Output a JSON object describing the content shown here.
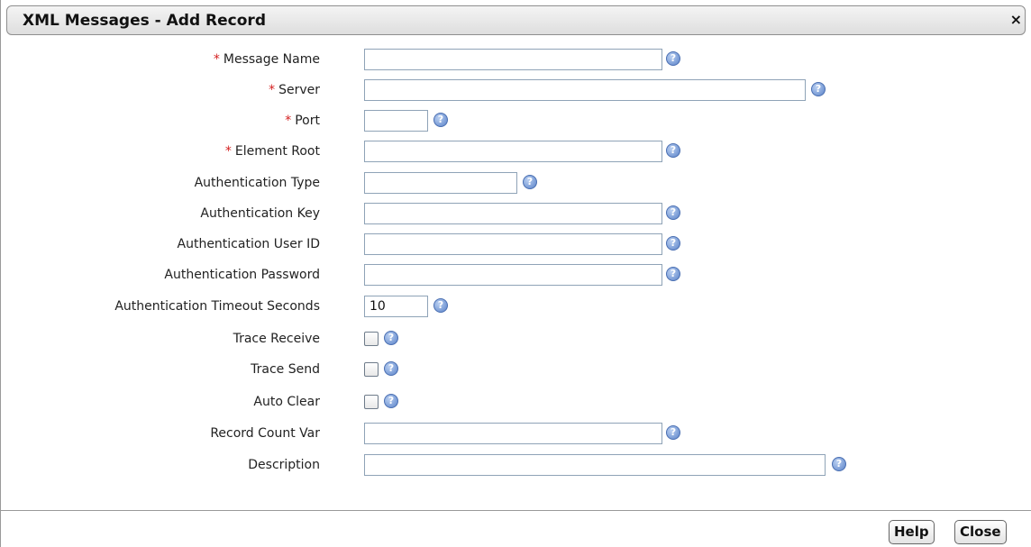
{
  "dialog": {
    "title": "XML Messages - Add Record",
    "close_glyph": "×"
  },
  "help_glyph": "?",
  "required_mark": "*",
  "fields": {
    "message_name": {
      "label": "Message Name",
      "value": ""
    },
    "server": {
      "label": "Server",
      "value": ""
    },
    "port": {
      "label": "Port",
      "value": ""
    },
    "element_root": {
      "label": "Element Root",
      "value": ""
    },
    "authentication_type": {
      "label": "Authentication Type",
      "value": ""
    },
    "authentication_key": {
      "label": "Authentication Key",
      "value": ""
    },
    "authentication_user_id": {
      "label": "Authentication User ID",
      "value": ""
    },
    "authentication_password": {
      "label": "Authentication Password",
      "value": ""
    },
    "authentication_timeout_seconds": {
      "label": "Authentication Timeout Seconds",
      "value": "10"
    },
    "trace_receive": {
      "label": "Trace Receive"
    },
    "trace_send": {
      "label": "Trace Send"
    },
    "auto_clear": {
      "label": "Auto Clear"
    },
    "record_count_var": {
      "label": "Record Count Var",
      "value": ""
    },
    "description": {
      "label": "Description",
      "value": ""
    }
  },
  "buttons": {
    "help": "Help",
    "close": "Close"
  }
}
